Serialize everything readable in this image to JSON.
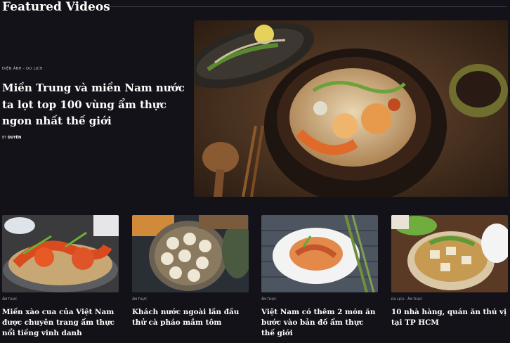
{
  "section": {
    "title": "Featured Videos"
  },
  "featured": {
    "category": "Điện ảnh - Du lịch",
    "title": "Miền Trung và miền Nam nước ta lọt top 100 vùng ẩm thực ngon nhất thế giới",
    "author_prefix": "BY",
    "author": "DUYÊN",
    "image_icon": "food-photo"
  },
  "cards": [
    {
      "category": "Ẩm thực",
      "title": "Miến xào cua của Việt Nam được chuyên trang ẩm thực nổi tiếng vinh danh",
      "image_icon": "crab-noodle-photo"
    },
    {
      "category": "Ẩm thực",
      "title": "Khách nước ngoài lần đầu thử cà pháo mắm tôm",
      "image_icon": "fermented-dish-photo"
    },
    {
      "category": "Ẩm thực",
      "title": "Việt Nam có thêm 2 món ăn bước vào bản đồ ẩm thực thế giới",
      "image_icon": "noodle-plate-photo"
    },
    {
      "category": "Du lịch - Ẩm thực",
      "title": "10 nhà hàng, quán ăn thú vị tại TP HCM",
      "image_icon": "soup-bowl-photo"
    }
  ]
}
